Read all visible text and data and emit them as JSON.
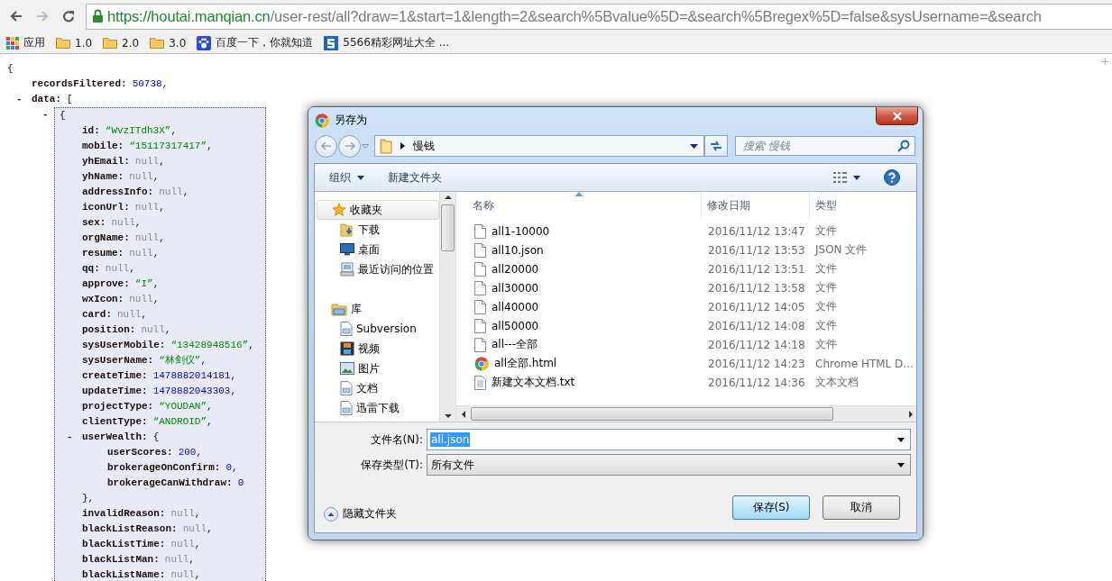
{
  "browser": {
    "toolbar": {
      "url_host": "https://houtai.manqian.cn",
      "url_path": "/user-rest/all?draw=1&start=1&length=2&search%5Bvalue%5D=&search%5Bregex%5D=false&sysUsername=&search"
    },
    "bookmarks": [
      {
        "kind": "apps",
        "label": "应用"
      },
      {
        "kind": "folder",
        "label": "1.0"
      },
      {
        "kind": "folder",
        "label": "2.0"
      },
      {
        "kind": "folder",
        "label": "3.0"
      },
      {
        "kind": "paw",
        "label": "百度一下，你就知道"
      },
      {
        "kind": "square",
        "label": "5566精彩网址大全 ..."
      }
    ]
  },
  "page": {
    "corner_mark": "+",
    "json_view": {
      "open": "{",
      "entries": [
        {
          "key": "recordsFiltered:",
          "value": "50738",
          "kind": "number",
          "punct": ","
        },
        {
          "key": "data:",
          "toggle": "-",
          "open": "[",
          "children": [
            {
              "toggle": "-",
              "open": "{",
              "selected": true,
              "children": [
                {
                  "key": "id:",
                  "value": "“WvzITdh3X”",
                  "kind": "string",
                  "punct": ","
                },
                {
                  "key": "mobile:",
                  "value": "“15117317417”",
                  "kind": "string",
                  "punct": ","
                },
                {
                  "key": "yhEmail:",
                  "value": "null",
                  "kind": "null",
                  "punct": ","
                },
                {
                  "key": "yhName:",
                  "value": "null",
                  "kind": "null",
                  "punct": ","
                },
                {
                  "key": "addressInfo:",
                  "value": "null",
                  "kind": "null",
                  "punct": ","
                },
                {
                  "key": "iconUrl:",
                  "value": "null",
                  "kind": "null",
                  "punct": ","
                },
                {
                  "key": "sex:",
                  "value": "null",
                  "kind": "null",
                  "punct": ","
                },
                {
                  "key": "orgName:",
                  "value": "null",
                  "kind": "null",
                  "punct": ","
                },
                {
                  "key": "resume:",
                  "value": "null",
                  "kind": "null",
                  "punct": ","
                },
                {
                  "key": "qq:",
                  "value": "null",
                  "kind": "null",
                  "punct": ","
                },
                {
                  "key": "approve:",
                  "value": "“I”",
                  "kind": "string",
                  "punct": ","
                },
                {
                  "key": "wxIcon:",
                  "value": "null",
                  "kind": "null",
                  "punct": ","
                },
                {
                  "key": "card:",
                  "value": "null",
                  "kind": "null",
                  "punct": ","
                },
                {
                  "key": "position:",
                  "value": "null",
                  "kind": "null",
                  "punct": ","
                },
                {
                  "key": "sysUserMobile:",
                  "value": "“13428948516”",
                  "kind": "string",
                  "punct": ","
                },
                {
                  "key": "sysUserName:",
                  "value": "“林剑仪”",
                  "kind": "string",
                  "punct": ","
                },
                {
                  "key": "createTime:",
                  "value": "1478882014181",
                  "kind": "number",
                  "punct": ","
                },
                {
                  "key": "updateTime:",
                  "value": "1478882043303",
                  "kind": "number",
                  "punct": ","
                },
                {
                  "key": "projectType:",
                  "value": "“YOUDAN”",
                  "kind": "string",
                  "punct": ","
                },
                {
                  "key": "clientType:",
                  "value": "“ANDROID”",
                  "kind": "string",
                  "punct": ","
                },
                {
                  "key": "userWealth:",
                  "toggle": "-",
                  "open": "{",
                  "close": "},",
                  "children": [
                    {
                      "key": "userScores:",
                      "value": "200",
                      "kind": "number",
                      "punct": ","
                    },
                    {
                      "key": "brokerageOnConfirm:",
                      "value": "0",
                      "kind": "number",
                      "punct": ","
                    },
                    {
                      "key": "brokerageCanWithdraw:",
                      "value": "0",
                      "kind": "number"
                    }
                  ]
                },
                {
                  "key": "invalidReason:",
                  "value": "null",
                  "kind": "null",
                  "punct": ","
                },
                {
                  "key": "blackListReason:",
                  "value": "null",
                  "kind": "null",
                  "punct": ","
                },
                {
                  "key": "blackListTime:",
                  "value": "null",
                  "kind": "null",
                  "punct": ","
                },
                {
                  "key": "blackListMan:",
                  "value": "null",
                  "kind": "null",
                  "punct": ","
                },
                {
                  "key": "blackListName:",
                  "value": "null",
                  "kind": "null",
                  "punct": ","
                }
              ]
            }
          ]
        }
      ]
    }
  },
  "dialog": {
    "title": "另存为",
    "location": "慢钱",
    "search_placeholder": "搜索 慢钱",
    "toolbar": {
      "organize": "组织",
      "new_folder": "新建文件夹"
    },
    "nav": [
      {
        "label": "收藏夹",
        "kind": "star",
        "selected": true,
        "children": [
          {
            "label": "下载",
            "kind": "download",
            "selected": false
          },
          {
            "label": "桌面",
            "kind": "desktop",
            "selected": false
          },
          {
            "label": "最近访问的位置",
            "kind": "recent",
            "selected": false
          }
        ]
      },
      {
        "label": "库",
        "kind": "library",
        "selected": false,
        "children": [
          {
            "label": "Subversion",
            "kind": "doc",
            "selected": false
          },
          {
            "label": "视频",
            "kind": "film",
            "selected": false
          },
          {
            "label": "图片",
            "kind": "image",
            "selected": false
          },
          {
            "label": "文档",
            "kind": "doc",
            "selected": false
          },
          {
            "label": "迅雷下载",
            "kind": "doc",
            "selected": false
          }
        ]
      }
    ],
    "columns": [
      {
        "label": "名称",
        "sorted": true
      },
      {
        "label": "修改日期",
        "sorted": false
      },
      {
        "label": "类型",
        "sorted": false
      }
    ],
    "files": [
      {
        "name": "all1-10000",
        "date": "2016/11/12 13:47",
        "type": "文件",
        "kind": "file"
      },
      {
        "name": "all10.json",
        "date": "2016/11/12 13:53",
        "type": "JSON 文件",
        "kind": "file"
      },
      {
        "name": "all20000",
        "date": "2016/11/12 13:51",
        "type": "文件",
        "kind": "file"
      },
      {
        "name": "all30000",
        "date": "2016/11/12 13:58",
        "type": "文件",
        "kind": "file"
      },
      {
        "name": "all40000",
        "date": "2016/11/12 14:05",
        "type": "文件",
        "kind": "file"
      },
      {
        "name": "all50000",
        "date": "2016/11/12 14:08",
        "type": "文件",
        "kind": "file"
      },
      {
        "name": "all---全部",
        "date": "2016/11/12 14:18",
        "type": "文件",
        "kind": "file"
      },
      {
        "name": "all全部.html",
        "date": "2016/11/12 14:23",
        "type": "Chrome HTML D...",
        "kind": "web"
      },
      {
        "name": "新建文本文档.txt",
        "date": "2016/11/12 14:36",
        "type": "文本文档",
        "kind": "text"
      }
    ],
    "filename": {
      "label": "文件名(N):",
      "value": "all.json",
      "selected": true
    },
    "filetype": {
      "label": "保存类型(T):",
      "value": "所有文件"
    },
    "hide_folders": "隐藏文件夹",
    "buttons": [
      {
        "label": "保存(S)",
        "default": true
      },
      {
        "label": "取消",
        "default": false
      }
    ]
  }
}
